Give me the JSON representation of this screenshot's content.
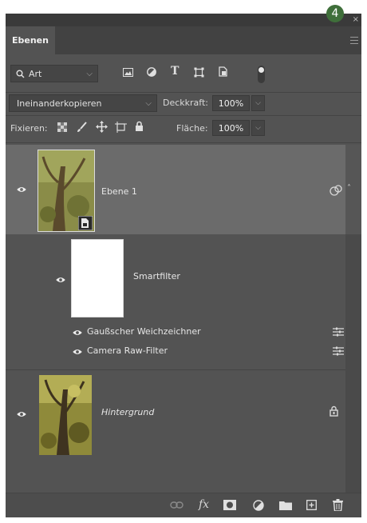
{
  "badge": "4",
  "panel": {
    "tab_label": "Ebenen",
    "close_glyph": "×"
  },
  "filter": {
    "kind_label": "Art",
    "kind_icons": [
      "image-filter-icon",
      "adjustment-filter-icon",
      "type-filter-icon",
      "shape-filter-icon",
      "smartobject-filter-icon"
    ],
    "toggle_state": "on"
  },
  "blend": {
    "mode": "Ineinanderkopieren",
    "opacity_label": "Deckkraft:",
    "opacity_value": "100%"
  },
  "lock": {
    "label": "Fixieren:",
    "fill_label": "Fläche:",
    "fill_value": "100%"
  },
  "layers": [
    {
      "name": "Ebene 1",
      "type": "smart-object",
      "selected": true,
      "visible": true
    },
    {
      "name": "Hintergrund",
      "type": "background",
      "locked": true,
      "visible": true
    }
  ],
  "smartfilters": {
    "label": "Smartfilter",
    "items": [
      {
        "name": "Gaußscher Weichzeichner"
      },
      {
        "name": "Camera Raw-Filter"
      }
    ]
  },
  "bottom_icons": [
    "link-layers-icon",
    "fx-icon",
    "add-mask-icon",
    "adjustment-layer-icon",
    "group-folder-icon",
    "new-layer-icon",
    "delete-icon"
  ],
  "colors": {
    "panel_bg": "#535353",
    "selected_row": "#6b6b6b",
    "badge": "#3f6f3a"
  }
}
